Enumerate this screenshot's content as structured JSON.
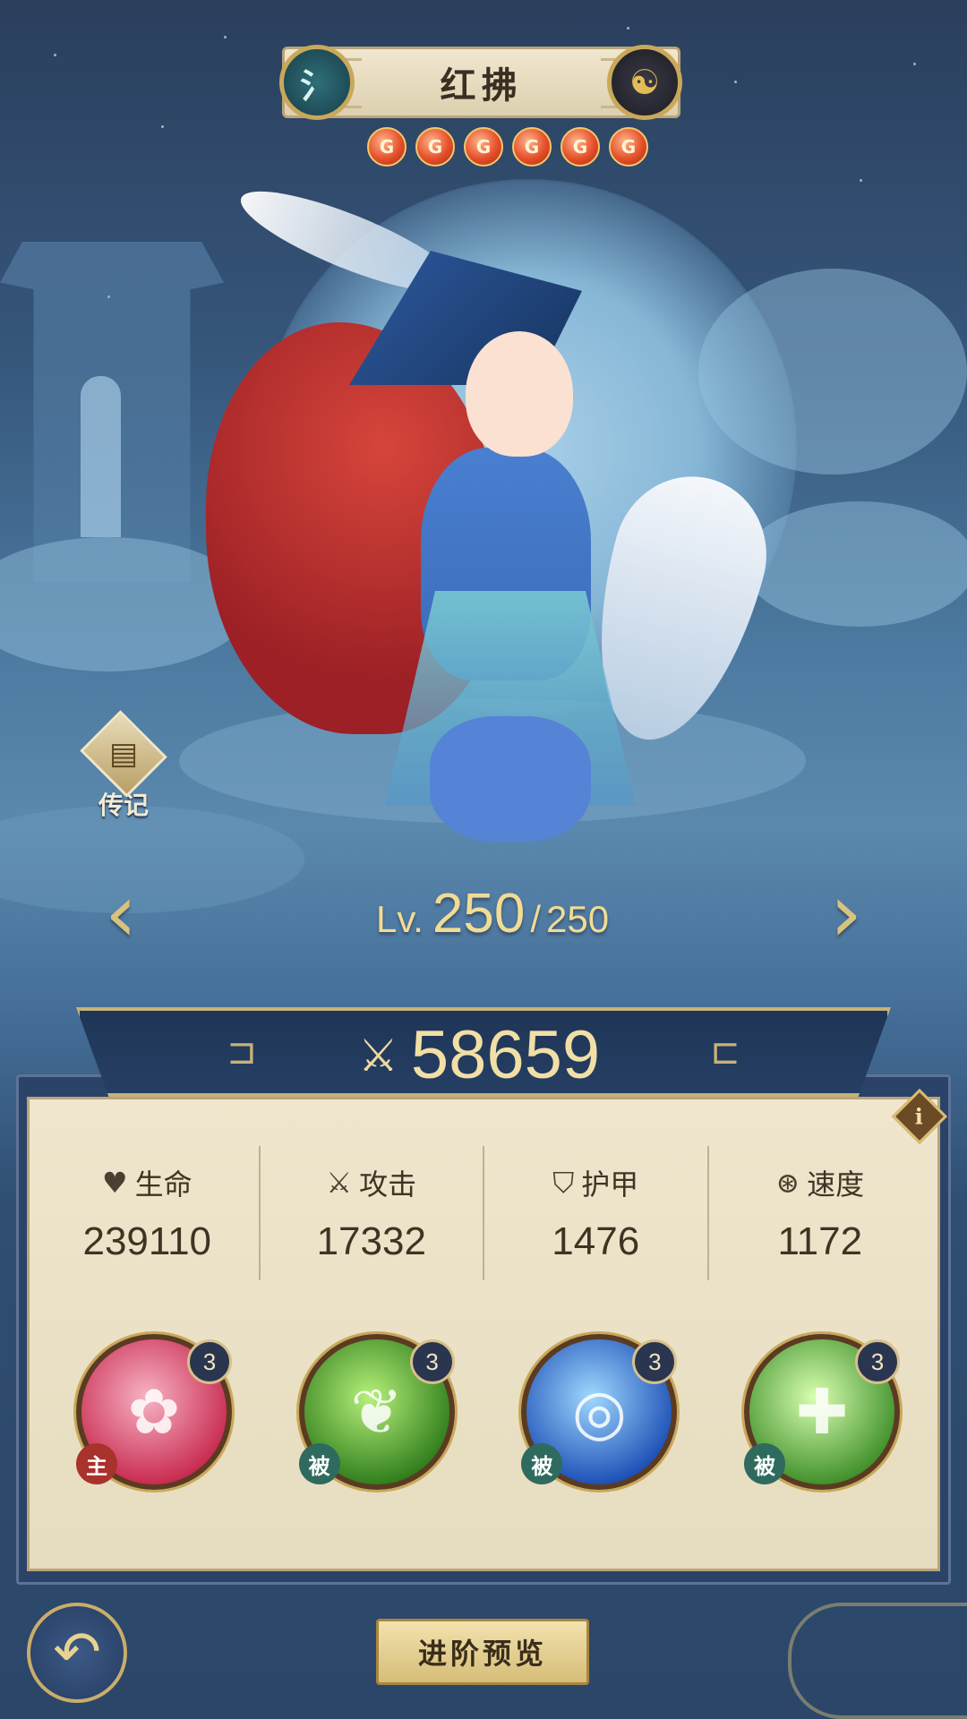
{
  "hero": {
    "name": "红拂",
    "faction_icon": "water-glyph-icon",
    "faction_glyph": "氵",
    "class_icon": "triskelion-icon",
    "class_glyph": "☯",
    "star_count": 6,
    "star_glyph": "G"
  },
  "biography": {
    "label": "传记",
    "icon": "book-icon"
  },
  "level": {
    "prefix": "Lv.",
    "current": "250",
    "separator": "/",
    "max": "250"
  },
  "power": {
    "icon": "sword-icon",
    "value": "58659"
  },
  "stats": [
    {
      "label": "生命",
      "value": "239110",
      "icon": "heart-icon",
      "glyph": "♥"
    },
    {
      "label": "攻击",
      "value": "17332",
      "icon": "crossed-swords-icon",
      "glyph": "⚔"
    },
    {
      "label": "护甲",
      "value": "1476",
      "icon": "shield-icon",
      "glyph": "⛉"
    },
    {
      "label": "速度",
      "value": "1172",
      "icon": "swirl-icon",
      "glyph": "⊛"
    }
  ],
  "skills": [
    {
      "level": "3",
      "tag": "主",
      "type": "active",
      "icon": "meditation-icon",
      "colors": [
        "#f7b3c4",
        "#c8294f"
      ]
    },
    {
      "level": "3",
      "tag": "被",
      "type": "passive",
      "icon": "green-beast-icon",
      "colors": [
        "#b6f07a",
        "#2f7d1c"
      ]
    },
    {
      "level": "3",
      "tag": "被",
      "type": "passive",
      "icon": "water-swirl-icon",
      "colors": [
        "#9fd8ff",
        "#1c4fb5"
      ]
    },
    {
      "level": "3",
      "tag": "被",
      "type": "passive",
      "icon": "heal-cross-icon",
      "colors": [
        "#d9ffb0",
        "#3f8f2a"
      ]
    }
  ],
  "buttons": {
    "advance_preview": "进阶预览",
    "back_icon": "back-arrow-icon"
  }
}
